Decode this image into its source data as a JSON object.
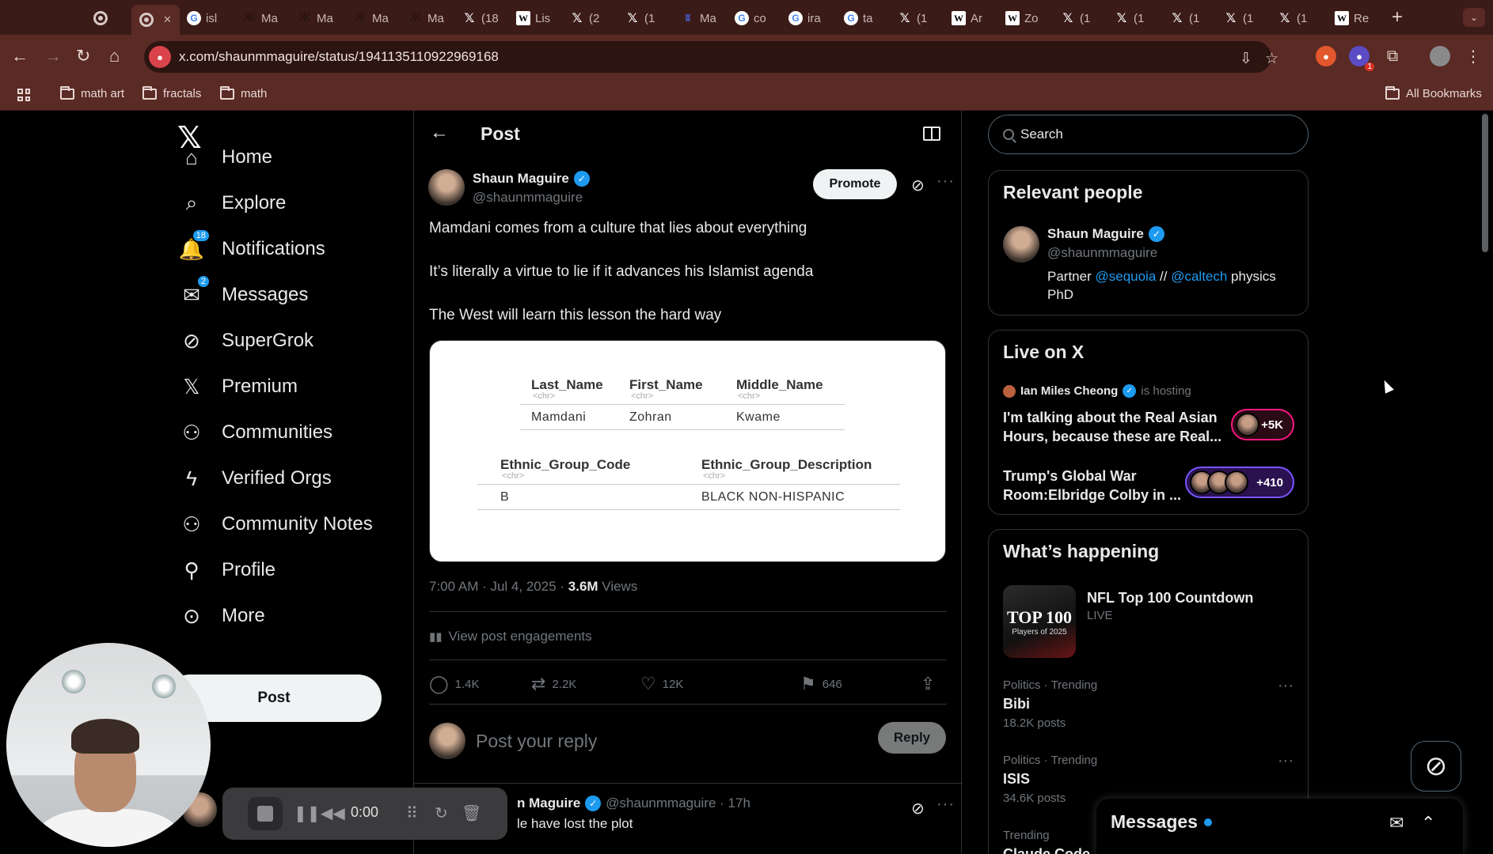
{
  "browser": {
    "tabs": [
      {
        "label": "",
        "icon": "record-icon"
      },
      {
        "label": "",
        "icon": "record-icon",
        "active": true
      },
      {
        "label": "isl",
        "icon": "google-icon"
      },
      {
        "label": "Ma",
        "icon": "mathworld-icon"
      },
      {
        "label": "Ma",
        "icon": "mathworld-icon"
      },
      {
        "label": "Ma",
        "icon": "mathworld-icon"
      },
      {
        "label": "Ma",
        "icon": "mathworld-icon"
      },
      {
        "label": "(18",
        "icon": "x-icon"
      },
      {
        "label": "Lis",
        "icon": "wikipedia-icon"
      },
      {
        "label": "(2",
        "icon": "x-icon"
      },
      {
        "label": "(1",
        "icon": "x-icon"
      },
      {
        "label": "Ma",
        "icon": "app-icon"
      },
      {
        "label": "co",
        "icon": "google-icon"
      },
      {
        "label": "ira",
        "icon": "google-icon"
      },
      {
        "label": "ta",
        "icon": "google-icon"
      },
      {
        "label": "(1",
        "icon": "x-icon"
      },
      {
        "label": "Ar",
        "icon": "wikipedia-icon"
      },
      {
        "label": "Zo",
        "icon": "wikipedia-icon"
      },
      {
        "label": "(1",
        "icon": "x-icon"
      },
      {
        "label": "(1",
        "icon": "x-icon"
      },
      {
        "label": "(1",
        "icon": "x-icon"
      },
      {
        "label": "(1",
        "icon": "x-icon"
      },
      {
        "label": "(1",
        "icon": "x-icon"
      },
      {
        "label": "Re",
        "icon": "wikipedia-icon"
      }
    ],
    "url": "x.com/shaunmmaguire/status/1941135110922969168",
    "extension_badge": "1",
    "bookmarks": [
      "math art",
      "fractals",
      "math"
    ],
    "all_bookmarks": "All Bookmarks"
  },
  "nav": {
    "items": [
      {
        "label": "Home",
        "icon": "home-icon"
      },
      {
        "label": "Explore",
        "icon": "search-icon"
      },
      {
        "label": "Notifications",
        "icon": "bell-icon",
        "badge": "18"
      },
      {
        "label": "Messages",
        "icon": "envelope-icon",
        "badge": "2"
      },
      {
        "label": "SuperGrok",
        "icon": "grok-icon"
      },
      {
        "label": "Premium",
        "icon": "x-icon"
      },
      {
        "label": "Communities",
        "icon": "people-icon"
      },
      {
        "label": "Verified Orgs",
        "icon": "lightning-icon"
      },
      {
        "label": "Community Notes",
        "icon": "community-notes-icon"
      },
      {
        "label": "Profile",
        "icon": "person-icon"
      },
      {
        "label": "More",
        "icon": "more-circle-icon"
      }
    ],
    "post_button": "Post"
  },
  "post": {
    "header_title": "Post",
    "author_name": "Shaun Maguire",
    "author_handle": "@shaunmmaguire",
    "promote": "Promote",
    "lines": [
      "Mamdani comes from a culture that lies about everything",
      "It’s literally a virtue to lie if it advances his Islamist agenda",
      "The West will learn this lesson the hard way"
    ],
    "media": {
      "table1": {
        "headers": [
          "Last_Name",
          "First_Name",
          "Middle_Name"
        ],
        "types": [
          "<chr>",
          "<chr>",
          "<chr>"
        ],
        "row": [
          "Mamdani",
          "Zohran",
          "Kwame"
        ]
      },
      "table2": {
        "headers": [
          "Ethnic_Group_Code",
          "Ethnic_Group_Description"
        ],
        "types": [
          "<chr>",
          "<chr>"
        ],
        "row": [
          "B",
          "BLACK NON-HISPANIC"
        ]
      }
    },
    "time": "7:00 AM · Jul 4, 2025 · ",
    "views_count": "3.6M",
    "views_label": " Views",
    "view_engagements": "View post engagements",
    "replies": "1.4K",
    "reposts": "2.2K",
    "likes": "12K",
    "bookmarks": "646",
    "reply_placeholder": "Post your reply",
    "reply_button": "Reply"
  },
  "reply": {
    "name": "Shaun Maguire",
    "name_visible": "n Maguire",
    "handle_time": "@shaunmmaguire · 17h",
    "text_visible": "le have lost the plot"
  },
  "sidebar": {
    "search_placeholder": "Search",
    "relevant_title": "Relevant people",
    "person": {
      "name": "Shaun Maguire",
      "handle": "@shaunmmaguire",
      "bio_pre": "Partner ",
      "bio_link1": "@sequoia",
      "bio_mid": " // ",
      "bio_link2": "@caltech",
      "bio_post": " physics PhD"
    },
    "live_title": "Live on X",
    "live_host": "Ian Miles Cheong",
    "live_host_status": "is hosting",
    "spaces": [
      {
        "title": "I'm talking about the Real Asian Hours, because these are Real...",
        "listeners": "+5K"
      },
      {
        "title": "Trump's Global War Room:Elbridge Colby in ...",
        "listeners": "+410"
      }
    ],
    "happening_title": "What’s happening",
    "featured": {
      "title": "NFL Top 100 Countdown",
      "status": "LIVE",
      "image_text": "TOP 100",
      "image_sub": "Players of 2025"
    },
    "trends": [
      {
        "category": "Politics · Trending",
        "name": "Bibi",
        "count": "18.2K posts"
      },
      {
        "category": "Politics · Trending",
        "name": "ISIS",
        "count": "34.6K posts"
      },
      {
        "category": "Trending",
        "name": "Claude Code",
        "count": ""
      }
    ]
  },
  "messages_drawer": {
    "title": "Messages"
  },
  "recorder": {
    "time": "0:00"
  },
  "colors": {
    "accent": "#1d9bf0",
    "chrome": "#5a2a24",
    "tabstrip": "#3b1b18"
  }
}
